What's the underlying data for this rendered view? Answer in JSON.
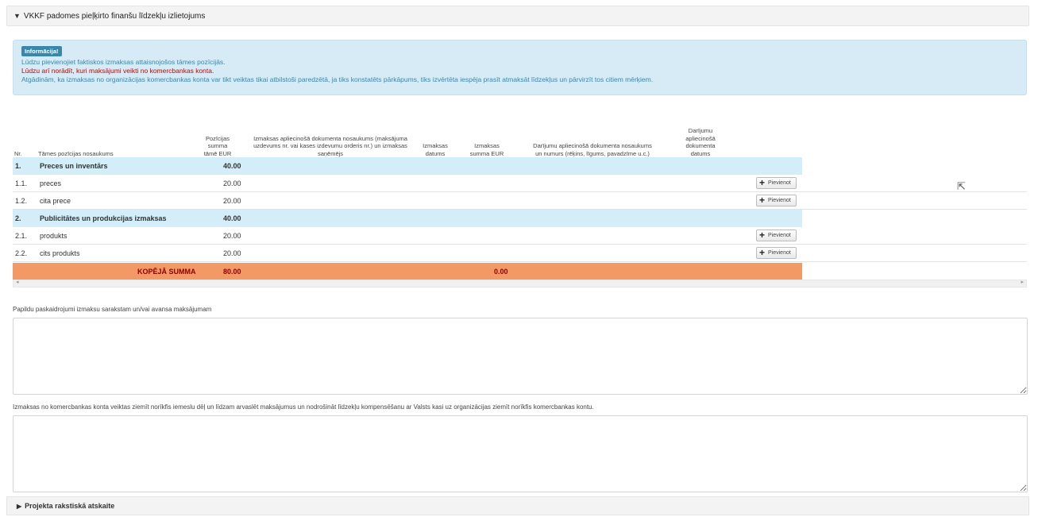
{
  "panel": {
    "caret": "▼",
    "title": "VKKF padomes pieļķirto finanšu līdzekļu izlietojums"
  },
  "info": {
    "badge": "Informācija!",
    "line1": "Lūdzu pievienojiet faktiskos izmaksas attaisnojošos tāmes pozīcijās.",
    "line2": "Lūdzu arī norādīt, kuri maksājumi veikti no komercbankas konta.",
    "line3": "Atgādinām, ka izmaksas no organizācijas komercbankas konta var tikt veiktas tikai atbilstoši paredzētā, ja tiks konstatēts pārkāpums, tiks izvērtēta iespēja prasīt atmaksāt līdzekļus un pārvirzīt tos citiem mērķiem."
  },
  "table": {
    "headers": {
      "nr": "Nr.",
      "name": "Tāmes pozīcijas nosaukums",
      "sum": "Pozīcijas summa tāmē EUR",
      "doc": "Izmaksas apliecinošā dokumenta nosaukums (maksājuma uzdevums nr. vai kases izdevumu orderis nr.) un izmaksas saņēmējs",
      "date": "Izmaksas datums",
      "amount": "Izmaksas summa EUR",
      "deal_doc": "Darījumu apliecinošā dokumenta nosaukums un numurs (rēķins, līgums, pavadzīme u.c.)",
      "deal_date": "Darījumu apliecinošā dokumenta datums"
    },
    "rows": [
      {
        "nr": "1.",
        "name": "Preces un inventārs",
        "sum": "40.00",
        "type": "group"
      },
      {
        "nr": "1.1.",
        "name": "preces",
        "sum": "20.00",
        "type": "item",
        "button": "Pievienot"
      },
      {
        "nr": "1.2.",
        "name": "cita prece",
        "sum": "20.00",
        "type": "item",
        "button": "Pievienot"
      },
      {
        "nr": "2.",
        "name": "Publicitātes un produkcijas izmaksas",
        "sum": "40.00",
        "type": "group"
      },
      {
        "nr": "2.1.",
        "name": "produkts",
        "sum": "20.00",
        "type": "item",
        "button": "Pievienot"
      },
      {
        "nr": "2.2.",
        "name": "cits produkts",
        "sum": "20.00",
        "type": "item",
        "button": "Pievienot"
      }
    ],
    "total": {
      "label": "KOPĒJĀ SUMMA",
      "sum": "80.00",
      "amount": "0.00"
    }
  },
  "field1": {
    "label": "Papildu paskaidrojumi izmaksu sarakstam un/vai avansa maksājumam",
    "value": ""
  },
  "field2": {
    "label": "Izmaksas no komercbankas konta veiktas ziemīt norīkfis iemeslu dēļ un līdzam arvaslēt maksājumus un nodrošināt līdzekļu kompensēšanu ar Valsts kasi uz organizācijas ziemīt norīkfis komercbankas kontu.",
    "value": ""
  },
  "bottom_panel": {
    "caret": "▶",
    "title": "Projekta rakstiskā atskaite"
  }
}
